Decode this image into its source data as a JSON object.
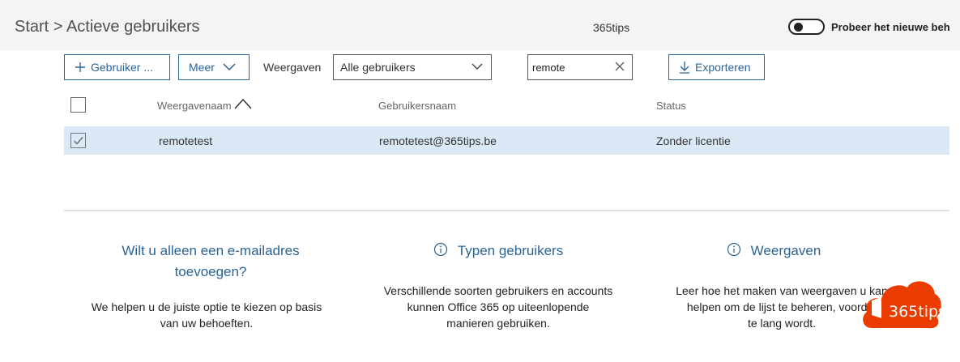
{
  "header": {
    "breadcrumb_root": "Start",
    "breadcrumb_sep": ">",
    "breadcrumb_current": "Actieve gebruikers",
    "tenant_name": "365tips",
    "toggle_label": "Probeer het nieuwe beh"
  },
  "toolbar": {
    "add_user_label": "Gebruiker ...",
    "more_label": "Meer",
    "views_label": "Weergaven",
    "views_selected": "Alle gebruikers",
    "search_value": "remote",
    "export_label": "Exporteren"
  },
  "table": {
    "columns": [
      "Weergavenaam",
      "Gebruikersnaam",
      "Status"
    ],
    "rows": [
      {
        "display_name": "remotetest",
        "username": "remotetest@365tips.be",
        "status": "Zonder licentie",
        "selected": true
      }
    ]
  },
  "cards": [
    {
      "title_line1": "Wilt u alleen een e-mailadres",
      "title_line2": "toevoegen?",
      "text_line1": "We helpen u de juiste optie te kiezen op basis",
      "text_line2": "van uw behoeften.",
      "text_line3": ""
    },
    {
      "title": "Typen gebruikers",
      "text_line1": "Verschillende soorten gebruikers en accounts",
      "text_line2": "kunnen Office 365 op uiteenlopende",
      "text_line3": "manieren gebruiken."
    },
    {
      "title": "Weergaven",
      "text_line1": "Leer hoe het maken van weergaven u kan",
      "text_line2": "helpen om de lijst te beheren, voordat",
      "text_line3": "te lang wordt."
    }
  ],
  "logo": {
    "text": "365tips"
  },
  "colors": {
    "accent": "#2a6496",
    "selected_row": "#dbe9f6",
    "logo_orange": "#eb3c00"
  }
}
